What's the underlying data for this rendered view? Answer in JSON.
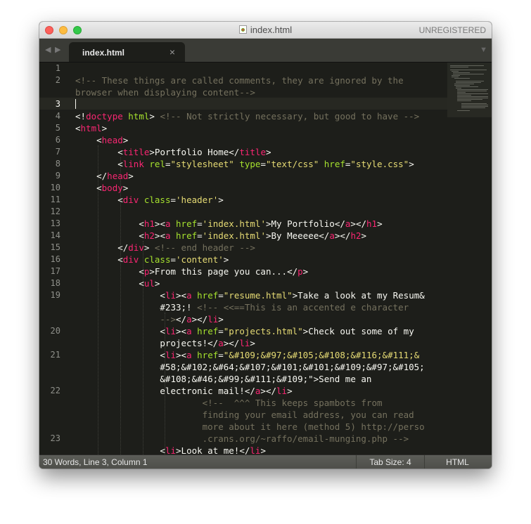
{
  "window": {
    "title": "index.html",
    "registration": "UNREGISTERED"
  },
  "tabs": [
    {
      "label": "index.html",
      "close": "×"
    }
  ],
  "tab_nav": {
    "back": "◀",
    "forward": "▶",
    "dropdown": "▼"
  },
  "gutter": [
    "1",
    "2",
    "",
    "3",
    "4",
    "5",
    "6",
    "7",
    "8",
    "9",
    "10",
    "11",
    "12",
    "13",
    "14",
    "15",
    "16",
    "17",
    "18",
    "19",
    "",
    "",
    "20",
    "",
    "21",
    "",
    "",
    "22",
    "",
    "",
    "",
    "23"
  ],
  "statusbar": {
    "info": "30 Words, Line 3, Column 1",
    "tab_size": "Tab Size: 4",
    "syntax": "HTML"
  },
  "code_lines": [
    "",
    "<!-- These things are called comments, they are ignored by the",
    "browser when displaying content-->",
    "",
    "<!doctype html> <!-- Not strictly necessary, but good to have --> ",
    "<html>",
    "    <head>",
    "        <title>Portfolio Home</title>",
    "        <link rel=\"stylesheet\" type=\"text/css\" href=\"style.css\">",
    "    </head>",
    "    <body>",
    "        <div class='header'>",
    "",
    "            <h1><a href='index.html'>My Portfolio</a></h1>",
    "            <h2><a href='index.html'>By Meeeee</a></h2>",
    "        </div> <!-- end header -->",
    "        <div class='content'>",
    "            <p>From this page you can...</p>",
    "            <ul>",
    "                <li><a href=\"resume.html\">Take a look at my Resum&",
    "                #233;! <!-- <<==This is an accented e character",
    "                --></a></li>",
    "                <li><a href=\"projects.html\">Check out some of my",
    "                projects!</a></li>",
    "                <li><a href=\"&#109;&#97;&#105;&#108;&#116;&#111;&",
    "                #58;&#102;&#64;&#107;&#101;&#101;&#109;&#97;&#105;",
    "                &#108;&#46;&#99;&#111;&#109;\">Send me an",
    "                electronic mail!</a></li>",
    "                        <!--  ^^^ This keeps spambots from",
    "                        finding your email address, you can read",
    "                        more about it here (method 5) http://perso",
    "                        .crans.org/~raffo/email-munging.php -->",
    "                <li>Look at me!</li>"
  ]
}
